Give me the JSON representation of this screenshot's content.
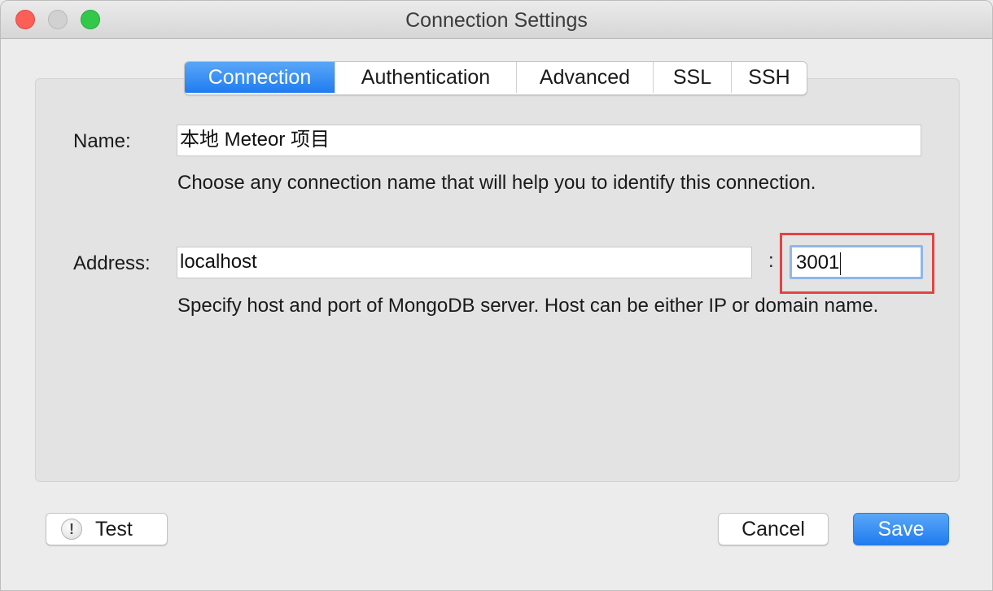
{
  "window": {
    "title": "Connection Settings"
  },
  "tabs": [
    {
      "label": "Connection",
      "active": true
    },
    {
      "label": "Authentication",
      "active": false
    },
    {
      "label": "Advanced",
      "active": false
    },
    {
      "label": "SSL",
      "active": false
    },
    {
      "label": "SSH",
      "active": false
    }
  ],
  "form": {
    "name_label": "Name:",
    "name_value": "本地 Meteor 项目",
    "name_help": "Choose any connection name that will help you to identify this connection.",
    "address_label": "Address:",
    "host_value": "localhost",
    "port_separator": ":",
    "port_value": "3001",
    "address_help": "Specify host and port of MongoDB server. Host can be either IP or domain name."
  },
  "buttons": {
    "test_label": "Test",
    "test_icon": "!",
    "cancel_label": "Cancel",
    "save_label": "Save"
  },
  "colors": {
    "accent": "#1f7cf0",
    "highlight": "#e84141",
    "close": "#fc5f57",
    "minimize": "#d1d1d1",
    "zoom": "#34c84a"
  }
}
